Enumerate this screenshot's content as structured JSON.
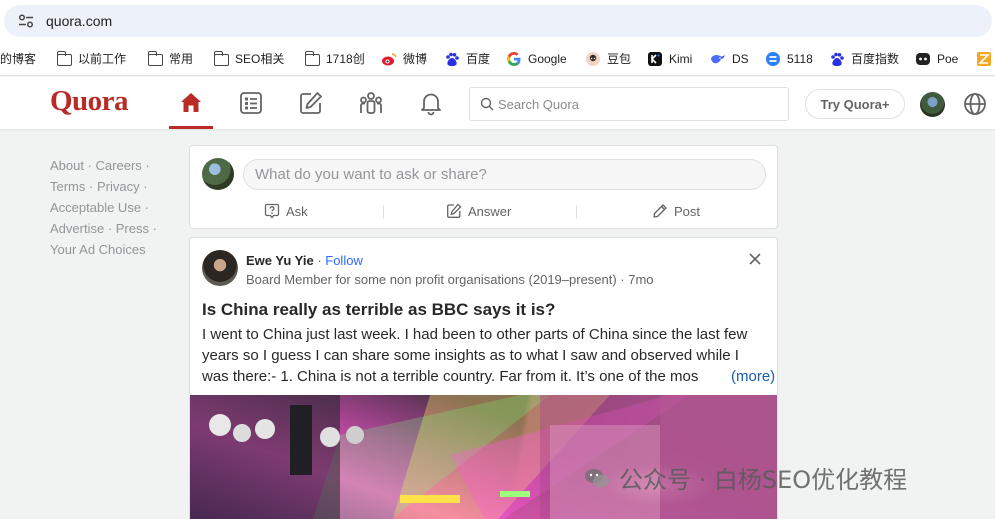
{
  "browser": {
    "url": "quora.com",
    "bookmarks": [
      {
        "label": "的博客",
        "icon": "site-icon"
      },
      {
        "label": "以前工作",
        "icon": "folder-icon"
      },
      {
        "label": "常用",
        "icon": "folder-icon"
      },
      {
        "label": "SEO相关",
        "icon": "folder-icon"
      },
      {
        "label": "1718创",
        "icon": "folder-icon"
      },
      {
        "label": "微博",
        "icon": "weibo-icon"
      },
      {
        "label": "百度",
        "icon": "baidu-icon"
      },
      {
        "label": "Google",
        "icon": "google-icon"
      },
      {
        "label": "豆包",
        "icon": "doubao-icon"
      },
      {
        "label": "Kimi",
        "icon": "kimi-icon"
      },
      {
        "label": "DS",
        "icon": "deepseek-icon"
      },
      {
        "label": "5118",
        "icon": "5118-icon"
      },
      {
        "label": "百度指数",
        "icon": "baidu-icon"
      },
      {
        "label": "Poe",
        "icon": "poe-icon"
      }
    ]
  },
  "header": {
    "logo": "Quora",
    "search_placeholder": "Search Quora",
    "try_button": "Try Quora+"
  },
  "sidebar": {
    "links": [
      "About",
      "Careers",
      "Terms",
      "Privacy",
      "Acceptable Use",
      "Advertise",
      "Press",
      "Your Ad Choices"
    ]
  },
  "ask_box": {
    "placeholder": "What do you want to ask or share?",
    "ask": "Ask",
    "answer": "Answer",
    "post": "Post"
  },
  "post": {
    "author": "Ewe Yu Yie",
    "separator": " · ",
    "follow": "Follow",
    "credential": "Board Member for some non profit organisations (2019–present) · 7mo",
    "question": "Is China really as terrible as BBC says it is?",
    "answer_lines": [
      "I went to China just last week. I had been to other parts of China since the last few",
      "years so I guess I can share some insights as to what I saw and observed while I",
      "was there:- 1. China is not a terrible country. Far from it. It’s one of the mos"
    ],
    "more": "(more)"
  },
  "watermark": "公众号 · 白杨SEO优化教程"
}
